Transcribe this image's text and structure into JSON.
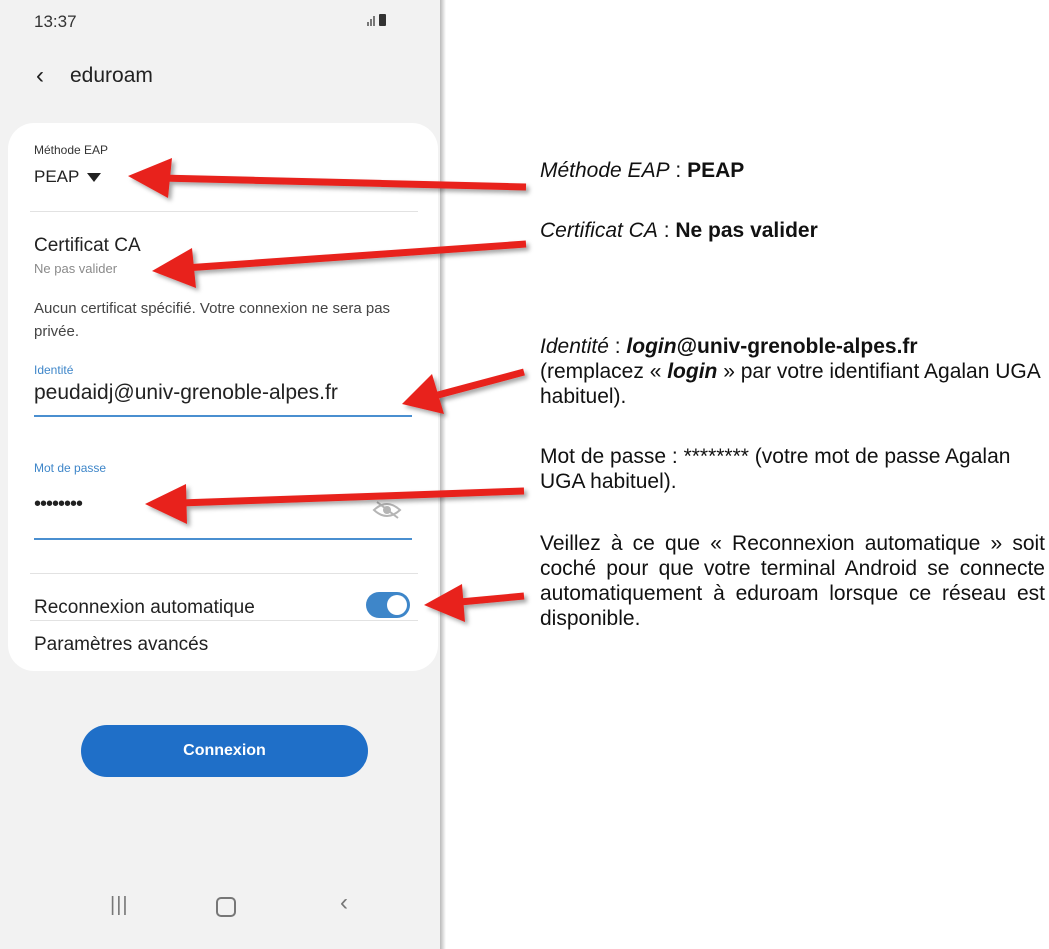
{
  "status_bar": {
    "time": "13:37"
  },
  "header": {
    "back_icon": "chevron-left-icon",
    "title": "eduroam"
  },
  "form": {
    "eap_label": "Méthode EAP",
    "eap_value": "PEAP",
    "ca_title": "Certificat CA",
    "ca_value": "Ne pas valider",
    "ca_warning": "Aucun certificat spécifié. Votre connexion ne sera pas privée.",
    "identity_label": "Identité",
    "identity_value": "peudaidj@univ-grenoble-alpes.fr",
    "password_label": "Mot de passe",
    "password_value": "••••••••",
    "auto_reconnect_label": "Reconnexion automatique",
    "auto_reconnect_on": true,
    "advanced_label": "Paramètres avancés"
  },
  "connect_button": "Connexion",
  "nav_bar": {
    "recent_icon": "recent-apps-icon",
    "home_icon": "home-icon",
    "back_icon": "back-icon"
  },
  "colors": {
    "accent": "#3e86c9",
    "button": "#1f6fc8",
    "arrow": "#e8211c"
  },
  "annotations": {
    "eap": {
      "label": "Méthode EAP",
      "sep": " : ",
      "value": "PEAP"
    },
    "ca": {
      "label": "Certificat CA",
      "sep": " : ",
      "value": "Ne pas valider"
    },
    "identity": {
      "label": "Identité",
      "sep": " : ",
      "login": "login",
      "domain": "@univ-grenoble-alpes.fr",
      "text_a": "(remplacez « ",
      "text_login": "login",
      "text_b": " » par votre identifiant Agalan UGA habituel)."
    },
    "password": "Mot de passe : ******** (votre mot de passe Agalan UGA habituel).",
    "reconnect": "Veillez à ce que « Reconnexion automatique » soit coché pour que votre terminal Android se connecte automatiquement à eduroam lorsque ce réseau est disponible."
  }
}
